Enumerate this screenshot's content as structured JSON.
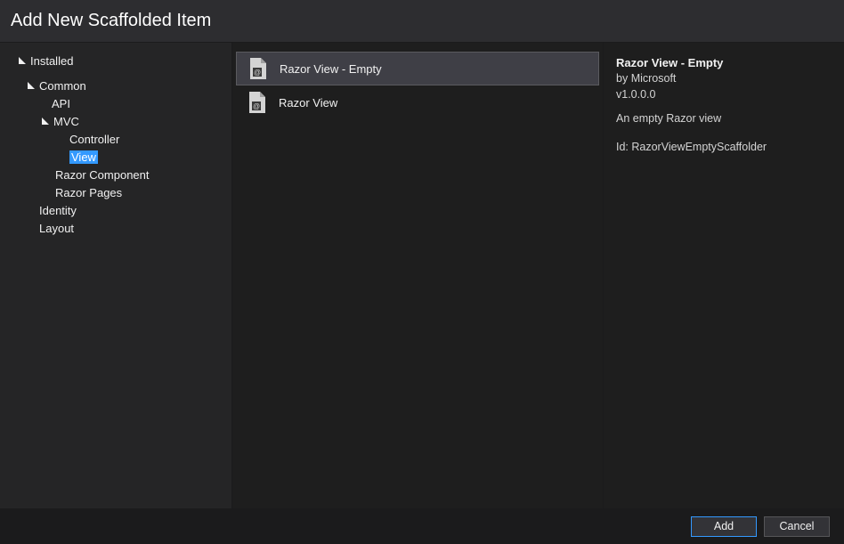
{
  "dialog": {
    "title": "Add New Scaffolded Item"
  },
  "sidebar": {
    "installed": "Installed",
    "common": "Common",
    "api": "API",
    "mvc": "MVC",
    "controller": "Controller",
    "view": "View",
    "razor_component": "Razor Component",
    "razor_pages": "Razor Pages",
    "identity": "Identity",
    "layout": "Layout"
  },
  "templates": {
    "items": [
      {
        "label": "Razor View - Empty",
        "selected": true
      },
      {
        "label": "Razor View",
        "selected": false
      }
    ]
  },
  "details": {
    "title": "Razor View - Empty",
    "by_prefix": "by ",
    "by_author": "Microsoft",
    "version": "v1.0.0.0",
    "description": "An empty Razor view",
    "id_prefix": "Id: ",
    "id_value": "RazorViewEmptyScaffolder"
  },
  "footer": {
    "add": "Add",
    "cancel": "Cancel"
  }
}
